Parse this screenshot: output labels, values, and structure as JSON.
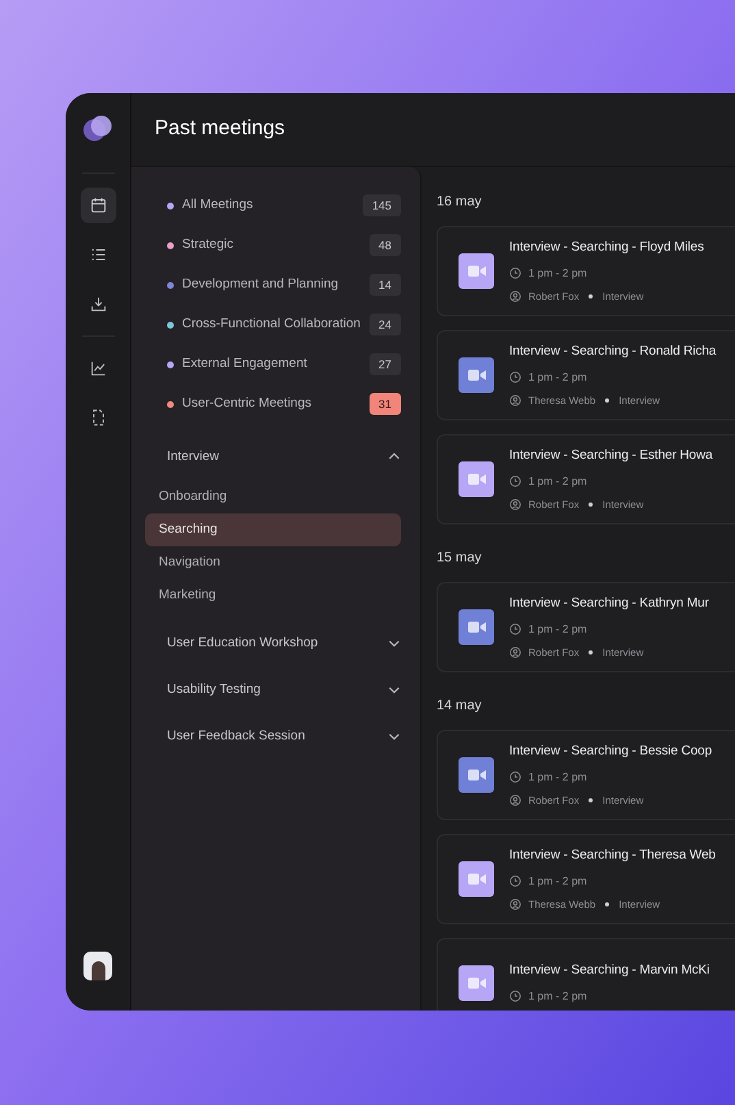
{
  "header": {
    "title": "Past meetings"
  },
  "rail": {
    "items": [
      {
        "kind": "calendar",
        "selected": true
      },
      {
        "kind": "list",
        "selected": false
      },
      {
        "kind": "download",
        "selected": false
      },
      {
        "kind": "chart",
        "selected": false
      },
      {
        "kind": "file",
        "selected": false
      }
    ]
  },
  "categories": [
    {
      "label": "All Meetings",
      "count": "145",
      "color": "#b7a6f5",
      "highlighted": false
    },
    {
      "label": "Strategic",
      "count": "48",
      "color": "#e9a0c8",
      "highlighted": false
    },
    {
      "label": "Development and Planning",
      "count": "14",
      "color": "#7d86d9",
      "highlighted": false
    },
    {
      "label": "Cross-Functional Collaboration",
      "count": "24",
      "color": "#7cc6d9",
      "highlighted": false
    },
    {
      "label": "External Engagement",
      "count": "27",
      "color": "#b7a6f5",
      "highlighted": false
    },
    {
      "label": "User-Centric Meetings",
      "count": "31",
      "color": "#f08a7e",
      "highlighted": true
    }
  ],
  "groups": [
    {
      "label": "Interview",
      "expanded": true,
      "children": [
        {
          "label": "Onboarding",
          "selected": false
        },
        {
          "label": "Searching",
          "selected": true
        },
        {
          "label": "Navigation",
          "selected": false
        },
        {
          "label": "Marketing",
          "selected": false
        }
      ]
    },
    {
      "label": "User Education Workshop",
      "expanded": false
    },
    {
      "label": "Usability Testing",
      "expanded": false
    },
    {
      "label": "User Feedback Session",
      "expanded": false
    }
  ],
  "days": [
    {
      "date": "16 may",
      "meetings": [
        {
          "title": "Interview - Searching - Floyd Miles",
          "time": "1 pm - 2 pm",
          "person": "Robert Fox",
          "tag": "Interview",
          "color": "#b7a6f5"
        },
        {
          "title": "Interview - Searching - Ronald Richa",
          "time": "1 pm - 2 pm",
          "person": "Theresa Webb",
          "tag": "Interview",
          "color": "#6f80d6"
        },
        {
          "title": "Interview - Searching - Esther Howa",
          "time": "1 pm - 2 pm",
          "person": "Robert Fox",
          "tag": "Interview",
          "color": "#b7a6f5"
        }
      ]
    },
    {
      "date": "15 may",
      "meetings": [
        {
          "title": "Interview - Searching - Kathryn Mur",
          "time": "1 pm - 2 pm",
          "person": "Robert Fox",
          "tag": "Interview",
          "color": "#6f80d6"
        }
      ]
    },
    {
      "date": "14 may",
      "meetings": [
        {
          "title": "Interview - Searching - Bessie Coop",
          "time": "1 pm - 2 pm",
          "person": "Robert Fox",
          "tag": "Interview",
          "color": "#6f80d6"
        },
        {
          "title": "Interview - Searching - Theresa Web",
          "time": "1 pm - 2 pm",
          "person": "Theresa Webb",
          "tag": "Interview",
          "color": "#b7a6f5"
        },
        {
          "title": "Interview - Searching - Marvin McKi",
          "time": "1 pm - 2 pm",
          "color": "#b7a6f5"
        }
      ]
    }
  ]
}
